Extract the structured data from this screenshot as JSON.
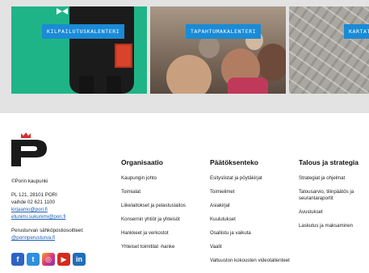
{
  "cards": [
    {
      "label": "KILPAILUTUSKALENTERI"
    },
    {
      "label": "TAPAHTUMAKALENTERI"
    },
    {
      "label": "KARTAT"
    }
  ],
  "footer": {
    "org_name": "©Porin kaupunki",
    "address": "PL 121, 28101 PORI",
    "phone": "vaihde 02 621 1100",
    "email_1": "kirjaamo@pori.fi",
    "email_2": "etunimi.sukunimi@pori.fi",
    "secure_mail_label": "Perusturvan sähköpostiosoitteet:",
    "secure_mail_link": "@porinperusturva.fi",
    "social": [
      {
        "icon": "facebook-icon",
        "glyph": "f"
      },
      {
        "icon": "twitter-icon",
        "glyph": "t"
      },
      {
        "icon": "instagram-icon",
        "glyph": "◎"
      },
      {
        "icon": "youtube-icon",
        "glyph": "▶"
      },
      {
        "icon": "linkedin-icon",
        "glyph": "in"
      }
    ],
    "columns": [
      {
        "title": "Organisaatio",
        "links": [
          "Kaupungin johto",
          "Toimialat",
          "Liikelaitokset ja pelastuslaitos",
          "Konsernin yhtiöt ja yhteisöt",
          "Hankkeet ja verkostot",
          "Yhteiset toimitilat -hanke"
        ]
      },
      {
        "title": "Päätöksenteko",
        "links": [
          "Esityslistat ja pöytäkirjat",
          "Toimielimet",
          "Asiakirjat",
          "Kuulutukset",
          "Osallistu ja vaikuta",
          "Vaalit",
          "Valtuuston kokousten videotallenteet"
        ]
      },
      {
        "title": "Talous ja strategia",
        "links": [
          "Strategiat ja ohjelmat",
          "Talousarvio, tilinpäätös ja seurantaraportit",
          "Avustukset",
          "Laskutus ja maksaminen"
        ]
      }
    ]
  },
  "colors": {
    "accent": "#1a8bd6",
    "logo": "#1a1a1a",
    "crown": "#d6302b"
  }
}
